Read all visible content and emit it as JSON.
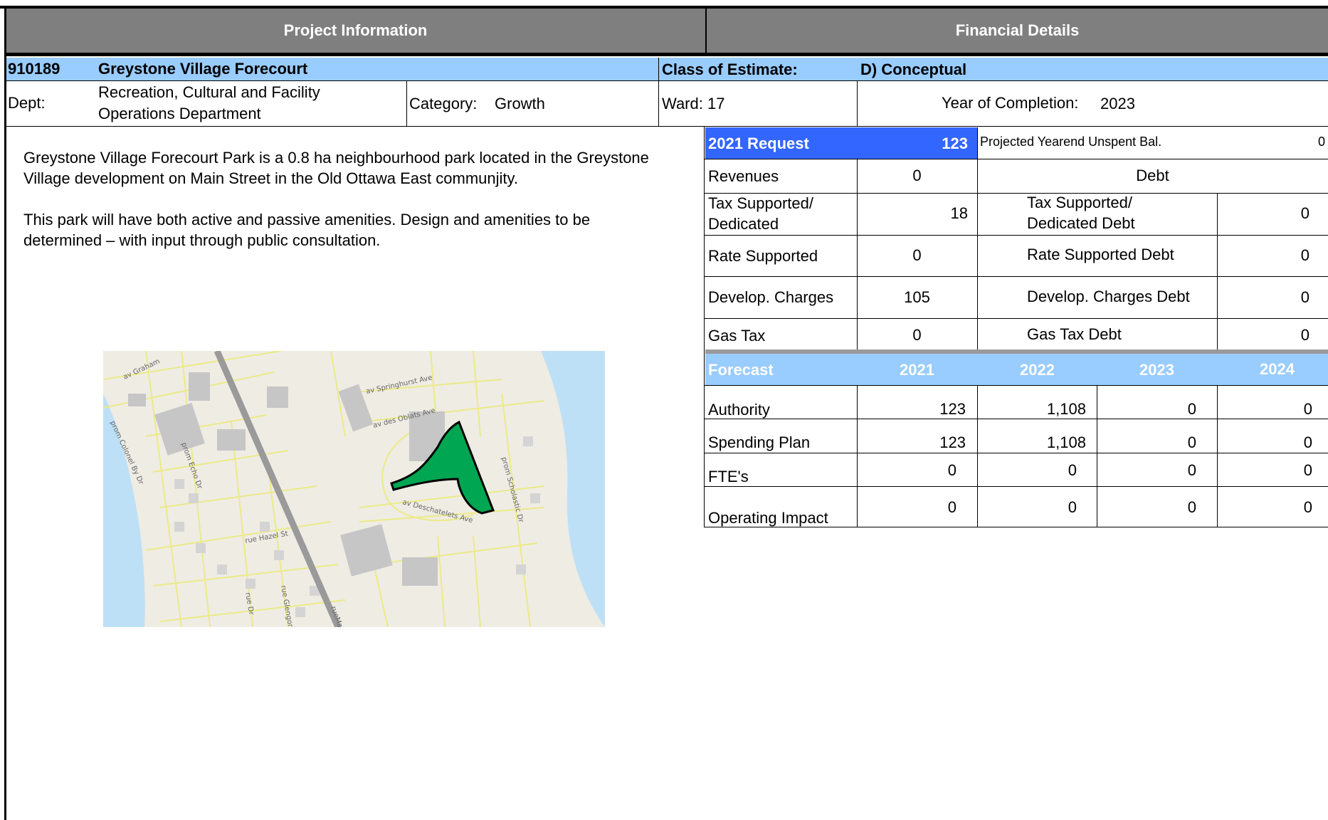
{
  "headers": {
    "project_info": "Project Information",
    "financial_details": "Financial Details"
  },
  "project": {
    "number": "910189",
    "name": "Greystone Village Forecourt",
    "class_label": "Class of Estimate:",
    "class_value": "D) Conceptual",
    "dept_label": "Dept:",
    "dept_line1": "Recreation, Cultural and Facility",
    "dept_line2": "Operations Department",
    "category_label": "Category:",
    "category_value": "Growth",
    "ward_label": "Ward:",
    "ward_value": "17",
    "completion_label": "Year of Completion:",
    "completion_value": "2023"
  },
  "description": {
    "p1_line1": "Greystone Village Forecourt Park is a 0.8 ha neighbourhood park located in the Greystone",
    "p1_line2": "Village development on Main Street in the Old Ottawa East communjity.",
    "p2_line1": "This park will have both active and passive amenities. Design and amenities to be",
    "p2_line2": "determined – with input through public consultation."
  },
  "map": {
    "streets": {
      "graham": "av Graham",
      "springhurst": "av Springhurst Ave",
      "oblats": "av des Oblats Ave",
      "deschatelets": "av Deschatelets Ave",
      "colonel_by": "prom Colonel By Dr",
      "echo": "prom Echo Dr",
      "scholastic": "prom Scholastic Dr",
      "hazel": "rue Hazel St",
      "main": "rueMainS",
      "glengora": "rue Glengora",
      "rue_dr": "rue Dr"
    }
  },
  "financial": {
    "request_label": "2021 Request",
    "request_value": "123",
    "unspent_label": "Projected Yearend Unspent Bal.",
    "unspent_value": "0",
    "debt_header": "Debt",
    "rows": [
      {
        "label1": "Revenues",
        "value": "0"
      },
      {
        "label1": "Tax Supported/",
        "label2": "Dedicated",
        "value": "18",
        "debt1": "Tax Supported/",
        "debt2": "Dedicated Debt",
        "debt_value": "0"
      },
      {
        "label1": "Rate Supported",
        "value": "0",
        "debt1": "Rate Supported Debt",
        "debt_value": "0"
      },
      {
        "label1": "Develop. Charges",
        "value": "105",
        "debt1": "Develop. Charges Debt",
        "debt_value": "0"
      },
      {
        "label1": "Gas Tax",
        "value": "0",
        "debt1": "Gas Tax Debt",
        "debt_value": "0"
      }
    ]
  },
  "forecast": {
    "label": "Forecast",
    "years": [
      "2021",
      "2022",
      "2023",
      "2024"
    ],
    "rows": [
      {
        "label": "Authority",
        "values": [
          "123",
          "1,108",
          "0",
          "0"
        ]
      },
      {
        "label": "Spending Plan",
        "values": [
          "123",
          "1,108",
          "0",
          "0"
        ]
      },
      {
        "label": "FTE's",
        "values": [
          "0",
          "0",
          "0",
          "0"
        ]
      },
      {
        "label": "Operating Impact",
        "values": [
          "0",
          "0",
          "0",
          "0"
        ]
      }
    ]
  },
  "colors": {
    "header_grey": "#7f7f7f",
    "light_blue": "#99ccff",
    "request_blue": "#3366ff",
    "park_green": "#00a651",
    "map_bg": "#efece4",
    "water": "#bde0f6",
    "road_yellow": "#ecea86"
  }
}
